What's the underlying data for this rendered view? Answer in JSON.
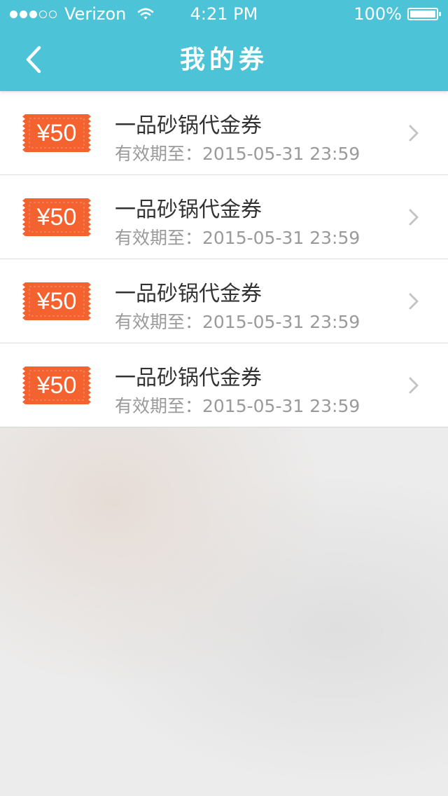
{
  "status_bar": {
    "carrier": "Verizon",
    "time": "4:21 PM",
    "battery": "100%",
    "signal_bars_filled": 3,
    "signal_bars_total": 5
  },
  "nav": {
    "title": "我的券",
    "back_icon": "chevron-left-icon"
  },
  "colors": {
    "accent": "#4cc3d6",
    "ticket": "#f4622f"
  },
  "coupons": [
    {
      "amount": "¥50",
      "name": "一品砂锅代金券",
      "expiry": "有效期至：2015-05-31 23:59"
    },
    {
      "amount": "¥50",
      "name": "一品砂锅代金券",
      "expiry": "有效期至：2015-05-31 23:59"
    },
    {
      "amount": "¥50",
      "name": "一品砂锅代金券",
      "expiry": "有效期至：2015-05-31 23:59"
    },
    {
      "amount": "¥50",
      "name": "一品砂锅代金券",
      "expiry": "有效期至：2015-05-31 23:59"
    }
  ]
}
